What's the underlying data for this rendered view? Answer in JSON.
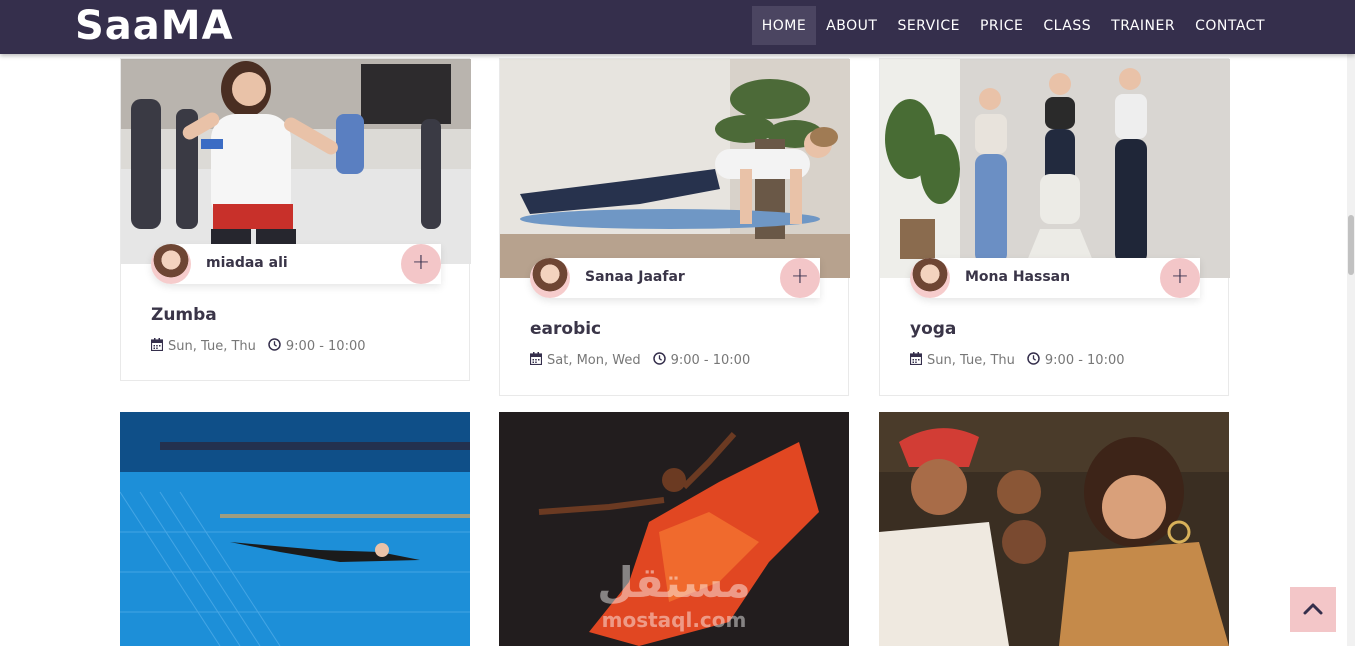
{
  "nav": {
    "brand": "SaaMA",
    "items": [
      "HOME",
      "ABOUT",
      "SERVICE",
      "PRICE",
      "CLASS",
      "TRAINER",
      "CONTACT"
    ],
    "active": "HOME"
  },
  "classes": [
    {
      "trainer": "miadaa ali",
      "title": "Zumba",
      "days": "Sun, Tue, Thu",
      "time": "9:00 - 10:00"
    },
    {
      "trainer": "Sanaa Jaafar",
      "title": "earobic",
      "days": "Sat, Mon, Wed",
      "time": "9:00 - 10:00"
    },
    {
      "trainer": "Mona Hassan",
      "title": "yoga",
      "days": "Sun, Tue, Thu",
      "time": "9:00 - 10:00"
    }
  ],
  "watermark": {
    "arabic": "مستقل",
    "latin": "mostaql.com"
  },
  "colors": {
    "navbar": "#352f4c",
    "accent_pink": "#f3c6c8",
    "text_dark": "#3a3548",
    "text_muted": "#777777"
  },
  "icons": {
    "calendar": "calendar-icon",
    "clock": "clock-icon",
    "plus": "plus-icon",
    "to_top": "chevron-up-icon"
  }
}
